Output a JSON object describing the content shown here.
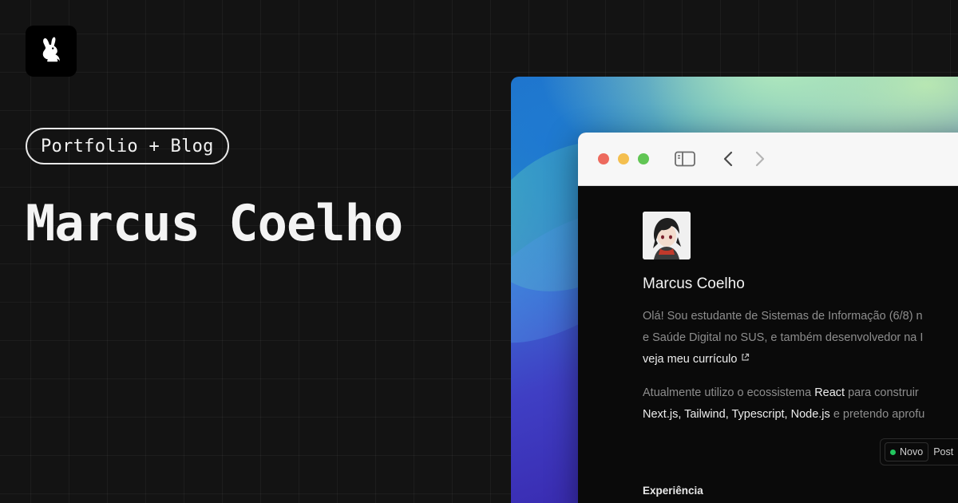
{
  "hero": {
    "pill_label": "Portfolio + Blog",
    "title": "Marcus Coelho"
  },
  "logo": {
    "icon": "rabbit-icon"
  },
  "browser": {
    "traffic_lights": {
      "close_color": "#ed6a5e",
      "minimize_color": "#f4bf4f",
      "zoom_color": "#61c554"
    },
    "toolbar_icons": [
      "sidebar-icon",
      "chevron-left-icon",
      "chevron-right-icon"
    ]
  },
  "site": {
    "name": "Marcus Coelho",
    "intro": {
      "line1": "Olá! Sou estudante de Sistemas de Informação (6/8) n",
      "line2": "e Saúde Digital no SUS, e também desenvolvedor na I",
      "link": "veja meu currículo"
    },
    "stack": {
      "prefix": "Atualmente utilizo o ecossistema ",
      "react": "React",
      "middle": " para construir",
      "tech": "Next.js, Tailwind, Typescript, Node.js",
      "suffix": " e pretendo aprofu"
    },
    "badge": {
      "label": "Novo",
      "dot_color": "#22c55e",
      "text": "Post"
    },
    "section_title": "Experiência"
  }
}
